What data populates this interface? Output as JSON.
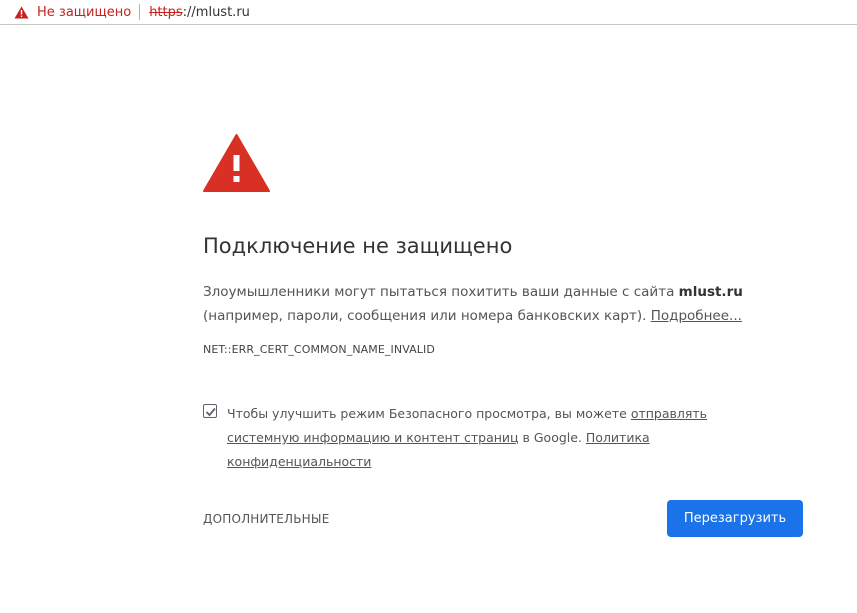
{
  "omnibox": {
    "status_text": "Не защищено",
    "url_scheme": "https",
    "url_rest": "://mlust.ru"
  },
  "page": {
    "title": "Подключение не защищено",
    "message_part1": "Злоумышленники могут пытаться похитить ваши данные с сайта ",
    "message_site": "mlust.ru",
    "message_part2": " (например, пароли, сообщения или номера банковских карт). ",
    "learn_more_link": "Подробнее...",
    "error_code": "NET::ERR_CERT_COMMON_NAME_INVALID",
    "checkbox_checked": true,
    "checkbox_text_part1": "Чтобы улучшить режим Безопасного просмотра, вы можете ",
    "checkbox_link1": "отправлять системную информацию и контент страниц",
    "checkbox_text_part2": " в Google. ",
    "checkbox_link2": "Политика конфиденциальности",
    "advanced_button": "ДОПОЛНИТЕЛЬНЫЕ",
    "reload_button": "Перезагрузить"
  },
  "colors": {
    "warning_red": "#d93025",
    "button_blue": "#1a73e8"
  },
  "icons": {
    "omnibox_icon": "warning-triangle-icon",
    "main_icon": "warning-triangle-icon",
    "checkbox_icon": "checkmark-icon"
  }
}
